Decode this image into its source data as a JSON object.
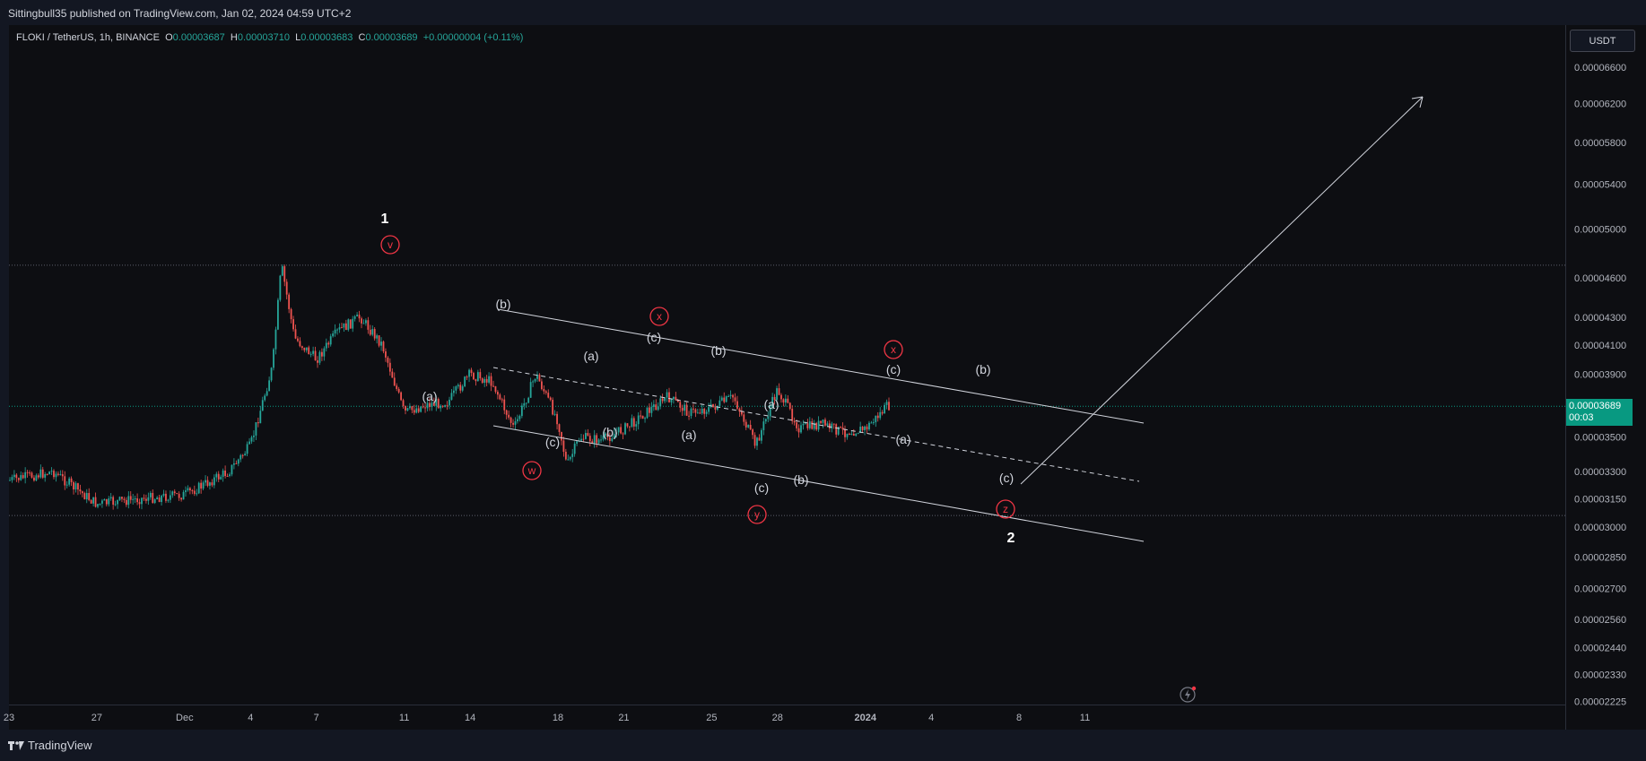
{
  "publish_line": "Sittingbull35 published on TradingView.com, Jan 02, 2024 04:59 UTC+2",
  "legend": {
    "symbol": "FLOKI / TetherUS, 1h, BINANCE",
    "o_label": "O",
    "o": "0.00003687",
    "h_label": "H",
    "h": "0.00003710",
    "l_label": "L",
    "l": "0.00003683",
    "c_label": "C",
    "c": "0.00003689",
    "change": "+0.00000004 (+0.11%)"
  },
  "currency": "USDT",
  "last_price": {
    "value": "0.00003689",
    "countdown": "00:03"
  },
  "brand": "TradingView",
  "colors": {
    "up": "#26a69a",
    "down": "#ef5350",
    "last_price_bg": "#089981",
    "wave_circle": "#f23645"
  },
  "chart_data": {
    "type": "candlestick",
    "scale": "log",
    "price_ticks": [
      "0.00006600",
      "0.00006200",
      "0.00005800",
      "0.00005400",
      "0.00005000",
      "0.00004600",
      "0.00004300",
      "0.00004100",
      "0.00003900",
      "0.00003500",
      "0.00003300",
      "0.00003150",
      "0.00003000",
      "0.00002850",
      "0.00002700",
      "0.00002560",
      "0.00002440",
      "0.00002330",
      "0.00002225"
    ],
    "time_ticks": [
      "23",
      "27",
      "Dec",
      "4",
      "7",
      "11",
      "14",
      "18",
      "21",
      "25",
      "28",
      "2024",
      "4",
      "8",
      "11"
    ],
    "ohlc_approx": [
      {
        "x": "Nov 23",
        "y": 3.25e-05
      },
      {
        "x": "Nov 25",
        "y": 3.3e-05
      },
      {
        "x": "Nov 27",
        "y": 3.12e-05
      },
      {
        "x": "Nov 29",
        "y": 3.15e-05
      },
      {
        "x": "Dec 1",
        "y": 3.17e-05
      },
      {
        "x": "Dec 3",
        "y": 3.3e-05
      },
      {
        "x": "Dec 4",
        "y": 3.45e-05
      },
      {
        "x": "Dec 5",
        "y": 3.95e-05
      },
      {
        "x": "Dec 5",
        "y": 4.7e-05
      },
      {
        "x": "Dec 6",
        "y": 4.15e-05
      },
      {
        "x": "Dec 7",
        "y": 4e-05
      },
      {
        "x": "Dec 8",
        "y": 4.2e-05
      },
      {
        "x": "Dec 9",
        "y": 4.3e-05
      },
      {
        "x": "Dec 10",
        "y": 4.1e-05
      },
      {
        "x": "Dec 11",
        "y": 3.65e-05
      },
      {
        "x": "Dec 12",
        "y": 3.7e-05
      },
      {
        "x": "Dec 13",
        "y": 3.72e-05
      },
      {
        "x": "Dec 14",
        "y": 3.9e-05
      },
      {
        "x": "Dec 15",
        "y": 3.85e-05
      },
      {
        "x": "Dec 16",
        "y": 3.55e-05
      },
      {
        "x": "Dec 17",
        "y": 3.9e-05
      },
      {
        "x": "Dec 18",
        "y": 3.6e-05
      },
      {
        "x": "Dec 18",
        "y": 3.33e-05
      },
      {
        "x": "Dec 19",
        "y": 3.5e-05
      },
      {
        "x": "Dec 20",
        "y": 3.48e-05
      },
      {
        "x": "Dec 21",
        "y": 3.55e-05
      },
      {
        "x": "Dec 22",
        "y": 3.65e-05
      },
      {
        "x": "Dec 23",
        "y": 3.75e-05
      },
      {
        "x": "Dec 24",
        "y": 3.65e-05
      },
      {
        "x": "Dec 25",
        "y": 3.68e-05
      },
      {
        "x": "Dec 26",
        "y": 3.75e-05
      },
      {
        "x": "Dec 27",
        "y": 3.45e-05
      },
      {
        "x": "Dec 28",
        "y": 3.8e-05
      },
      {
        "x": "Dec 29",
        "y": 3.55e-05
      },
      {
        "x": "Dec 30",
        "y": 3.58e-05
      },
      {
        "x": "Dec 31",
        "y": 3.53e-05
      },
      {
        "x": "Jan 1",
        "y": 3.55e-05
      },
      {
        "x": "Jan 2",
        "y": 3.69e-05
      }
    ],
    "wave_labels_major": [
      "1",
      "2"
    ],
    "wave_labels_circled": [
      "v",
      "w",
      "x",
      "y",
      "x",
      "z"
    ],
    "wave_labels_minor": [
      "(a)",
      "(b)",
      "(c)",
      "(a)",
      "(b)",
      "(c)",
      "(a)",
      "(b)",
      "(c)",
      "(a)",
      "(b)",
      "(c)",
      "(a)",
      "(b)",
      "(c)"
    ],
    "horizontal_levels": [
      4.7e-05,
      3.06e-05,
      3.69e-05
    ],
    "projection_target": 6.3e-05
  }
}
